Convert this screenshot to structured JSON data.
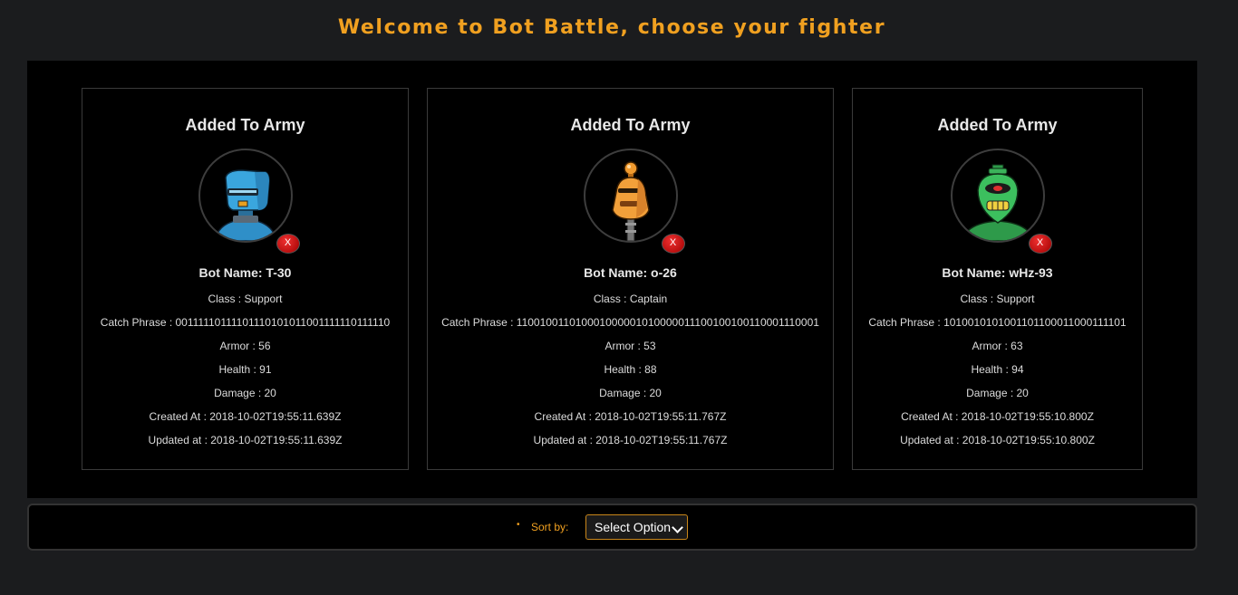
{
  "page": {
    "title": "Welcome to Bot Battle, choose your fighter",
    "accent_color": "#f0a020"
  },
  "army": [
    {
      "heading": "Added To Army",
      "avatar_icon": "robot-blue-avatar",
      "remove_label": "X",
      "name": "Bot Name: T-30",
      "class": "Class : Support",
      "catch_phrase": "Catch Phrase : 00111110111101110101011001111110111110",
      "armor": "Armor : 56",
      "health": "Health : 91",
      "damage": "Damage : 20",
      "created_at": "Created At : 2018-10-02T19:55:11.639Z",
      "updated_at": "Updated at : 2018-10-02T19:55:11.639Z"
    },
    {
      "heading": "Added To Army",
      "avatar_icon": "robot-orange-avatar",
      "remove_label": "X",
      "name": "Bot Name: o-26",
      "class": "Class : Captain",
      "catch_phrase": "Catch Phrase : 110010011010001000001010000011100100100110001110001",
      "armor": "Armor : 53",
      "health": "Health : 88",
      "damage": "Damage : 20",
      "created_at": "Created At : 2018-10-02T19:55:11.767Z",
      "updated_at": "Updated at : 2018-10-02T19:55:11.767Z"
    },
    {
      "heading": "Added To Army",
      "avatar_icon": "robot-green-avatar",
      "remove_label": "X",
      "name": "Bot Name: wHz-93",
      "class": "Class : Support",
      "catch_phrase": "Catch Phrase : 1010010101001101100011000111101",
      "armor": "Armor : 63",
      "health": "Health : 94",
      "damage": "Damage : 20",
      "created_at": "Created At : 2018-10-02T19:55:10.800Z",
      "updated_at": "Updated at : 2018-10-02T19:55:10.800Z"
    }
  ],
  "sort": {
    "bullet": "•",
    "label": "Sort by:",
    "selected": "Select Option"
  }
}
